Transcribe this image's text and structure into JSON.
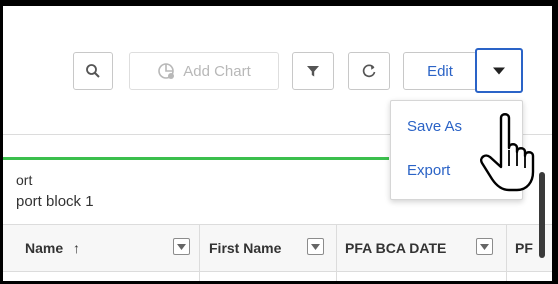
{
  "toolbar": {
    "search_icon": "search-icon",
    "add_chart_label": "Add Chart",
    "filter_icon": "filter-icon",
    "refresh_icon": "refresh-icon",
    "edit_label": "Edit",
    "dropdown_icon": "caret-down-icon"
  },
  "dropdown_menu": {
    "items": [
      {
        "label": "Save As"
      },
      {
        "label": "Export"
      }
    ]
  },
  "report": {
    "line1": "ort",
    "line2": "port block 1"
  },
  "table": {
    "columns": [
      {
        "label": "Name",
        "sort": "↑"
      },
      {
        "label": "First Name"
      },
      {
        "label": "PFA BCA DATE"
      },
      {
        "label": "PF"
      }
    ]
  },
  "colors": {
    "accent": "#2a63c7",
    "status_bar": "#3bbf4d"
  }
}
